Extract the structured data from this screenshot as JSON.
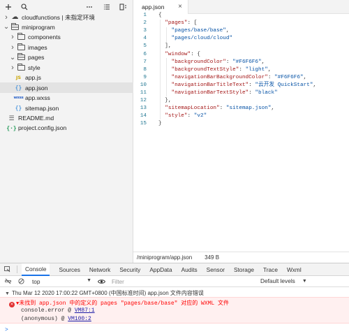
{
  "sidebar": {
    "toolbar_icons": [
      "plus-icon",
      "search-icon",
      "more-icon",
      "list-icon",
      "split-icon"
    ],
    "tree": [
      {
        "label": "cloudfunctions | 未指定环境",
        "icon": "cloud-folder",
        "chevron": "right",
        "depth": 0
      },
      {
        "label": "miniprogram",
        "icon": "folder-open",
        "chevron": "down",
        "depth": 0
      },
      {
        "label": "components",
        "icon": "folder",
        "chevron": "right",
        "depth": 1
      },
      {
        "label": "images",
        "icon": "folder",
        "chevron": "right",
        "depth": 1
      },
      {
        "label": "pages",
        "icon": "folder-open",
        "chevron": "down",
        "depth": 1
      },
      {
        "label": "style",
        "icon": "folder",
        "chevron": "right",
        "depth": 1
      },
      {
        "label": "app.js",
        "icon": "js",
        "chevron": "",
        "depth": 1
      },
      {
        "label": "app.json",
        "icon": "json",
        "chevron": "",
        "depth": 1,
        "selected": true
      },
      {
        "label": "app.wxss",
        "icon": "wxss",
        "chevron": "",
        "depth": 1
      },
      {
        "label": "sitemap.json",
        "icon": "json",
        "chevron": "",
        "depth": 1
      },
      {
        "label": "README.md",
        "icon": "md",
        "chevron": "",
        "depth": 0
      },
      {
        "label": "project.config.json",
        "icon": "proj",
        "chevron": "",
        "depth": 0
      }
    ]
  },
  "editor": {
    "tab_label": "app.json",
    "lines": [
      [
        [
          "p",
          "{"
        ]
      ],
      [
        [
          "p",
          "  "
        ],
        [
          "k",
          "\"pages\""
        ],
        [
          "p",
          ": ["
        ]
      ],
      [
        [
          "p",
          "    "
        ],
        [
          "s",
          "\"pages/base/base\""
        ],
        [
          "p",
          ","
        ]
      ],
      [
        [
          "p",
          "    "
        ],
        [
          "s",
          "\"pages/cloud/cloud\""
        ]
      ],
      [
        [
          "p",
          "  ],"
        ]
      ],
      [
        [
          "p",
          "  "
        ],
        [
          "k",
          "\"window\""
        ],
        [
          "p",
          ": {"
        ]
      ],
      [
        [
          "p",
          "    "
        ],
        [
          "k",
          "\"backgroundColor\""
        ],
        [
          "p",
          ": "
        ],
        [
          "s",
          "\"#F6F6F6\""
        ],
        [
          "p",
          ","
        ]
      ],
      [
        [
          "p",
          "    "
        ],
        [
          "k",
          "\"backgroundTextStyle\""
        ],
        [
          "p",
          ": "
        ],
        [
          "s",
          "\"light\""
        ],
        [
          "p",
          ","
        ]
      ],
      [
        [
          "p",
          "    "
        ],
        [
          "k",
          "\"navigationBarBackgroundColor\""
        ],
        [
          "p",
          ": "
        ],
        [
          "s",
          "\"#F6F6F6\""
        ],
        [
          "p",
          ","
        ]
      ],
      [
        [
          "p",
          "    "
        ],
        [
          "k",
          "\"navigationBarTitleText\""
        ],
        [
          "p",
          ": "
        ],
        [
          "s",
          "\"云开发 QuickStart\""
        ],
        [
          "p",
          ","
        ]
      ],
      [
        [
          "p",
          "    "
        ],
        [
          "k",
          "\"navigationBarTextStyle\""
        ],
        [
          "p",
          ": "
        ],
        [
          "s",
          "\"black\""
        ]
      ],
      [
        [
          "p",
          "  },"
        ]
      ],
      [
        [
          "p",
          "  "
        ],
        [
          "k",
          "\"sitemapLocation\""
        ],
        [
          "p",
          ": "
        ],
        [
          "s",
          "\"sitemap.json\""
        ],
        [
          "p",
          ","
        ]
      ],
      [
        [
          "p",
          "  "
        ],
        [
          "k",
          "\"style\""
        ],
        [
          "p",
          ": "
        ],
        [
          "s",
          "\"v2\""
        ]
      ],
      [
        [
          "p",
          "}"
        ]
      ]
    ],
    "status_path": "/miniprogram/app.json",
    "status_size": "349 B"
  },
  "devtools": {
    "tabs": [
      "Console",
      "Sources",
      "Network",
      "Security",
      "AppData",
      "Audits",
      "Sensor",
      "Storage",
      "Trace",
      "Wxml"
    ],
    "active_tab": "Console",
    "context": "top",
    "filter_placeholder": "Filter",
    "levels": "Default levels",
    "log_group": "Thu Mar 12 2020 17:00:22 GMT+0800 (中国标准时间)  app.json 文件内容错误",
    "error_message": "未找到 app.json 中的定义的 pages \"pages/base/base\" 对应的 WXML 文件",
    "stack": [
      {
        "func": "console.error @ ",
        "link": "VM87:1"
      },
      {
        "func": "(anonymous)  @ ",
        "link": "VM100:2"
      }
    ],
    "prompt": ">"
  },
  "colors": {
    "accent": "#1a73e8",
    "error": "#ff0000",
    "error_bg": "#fff0f0",
    "json_key": "#a31515",
    "json_string": "#0451a5",
    "line_number": "#237893"
  }
}
